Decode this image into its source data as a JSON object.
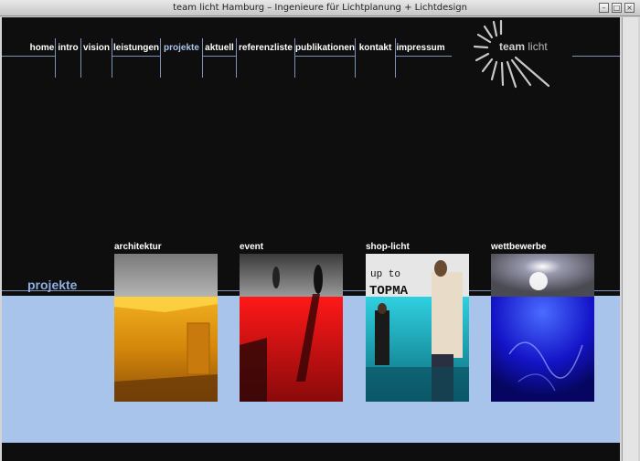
{
  "window": {
    "title": "team licht Hamburg – Ingenieure für Lichtplanung + Lichtdesign"
  },
  "nav": {
    "items": [
      {
        "label": "home"
      },
      {
        "label": "intro"
      },
      {
        "label": "vision"
      },
      {
        "label": "leistungen"
      },
      {
        "label": "projekte",
        "active": true
      },
      {
        "label": "aktuell"
      },
      {
        "label": "referenzliste"
      },
      {
        "label": "publikationen"
      },
      {
        "label": "kontakt"
      },
      {
        "label": "impressum"
      }
    ]
  },
  "logo": {
    "word1": "team",
    "word2": "licht"
  },
  "section": {
    "title": "projekte"
  },
  "categories": [
    {
      "label": "architektur"
    },
    {
      "label": "event"
    },
    {
      "label": "shop-licht",
      "photo_text": "up to\nTOPMA"
    },
    {
      "label": "wettbewerbe"
    }
  ],
  "colors": {
    "background": "#0e0e0e",
    "nav_text": "#ffffff",
    "nav_active": "#a9c4ea",
    "panel": "#a9c4ea",
    "lines": "#7a94b8"
  }
}
